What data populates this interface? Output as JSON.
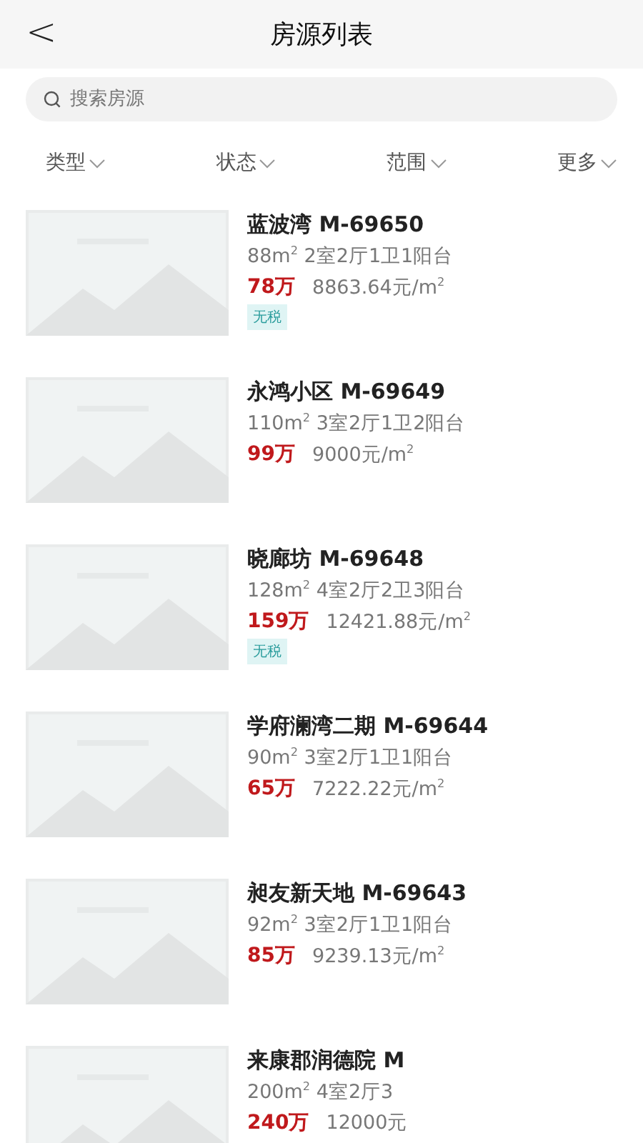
{
  "header": {
    "back": "<",
    "title": "房源列表"
  },
  "search": {
    "placeholder": "搜索房源"
  },
  "filters": [
    "类型",
    "状态",
    "范围",
    "更多"
  ],
  "listings": [
    {
      "title": "蓝波湾 M-69650",
      "specs": "88m$^{2}$ 2室2厅1卫1阳台",
      "price": "78万",
      "unit_price": "8863.64元/m$^{2}$",
      "tags": [
        "无税"
      ]
    },
    {
      "title": "永鸿小区 M-69649",
      "specs": "110m$^{2}$ 3室2厅1卫2阳台",
      "price": "99万",
      "unit_price": "9000元/m$^{2}$"
    },
    {
      "title": "晓廊坊 M-69648",
      "specs": "128m$^{2}$ 4室2厅2卫3阳台",
      "price": "159万",
      "unit_price": "12421.88元/m$^{2}$",
      "tags": [
        "无税"
      ]
    },
    {
      "title": "学府澜湾二期 M-69644",
      "specs": "90m$^{2}$ 3室2厅1卫1阳台",
      "price": "65万",
      "unit_price": "7222.22元/m$^{2}$"
    },
    {
      "title": "昶友新天地 M-69643",
      "specs": "92m$^{2}$ 3室2厅1卫1阳台",
      "price": "85万",
      "unit_price": "9239.13元/m$^{2}$"
    },
    {
      "title": "来康郡润德院 M",
      "specs": "200m$^{2}$ 4室2厅3",
      "price": "240万",
      "unit_price": "12000元"
    }
  ]
}
